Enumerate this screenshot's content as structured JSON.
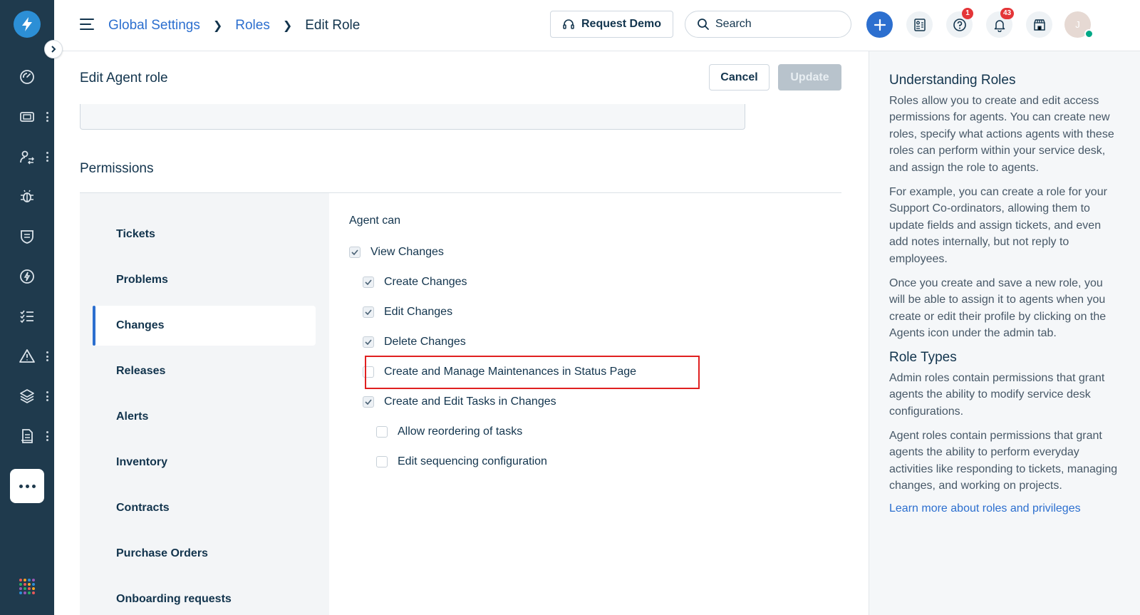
{
  "colors": {
    "sidebar_bg": "#1f3a4d",
    "accent": "#2c6fcf",
    "badge": "#e43538",
    "highlight": "#e02020",
    "online": "#00a886"
  },
  "header": {
    "breadcrumb": [
      "Global Settings",
      "Roles",
      "Edit Role"
    ],
    "demo_label": "Request Demo",
    "search_placeholder": "Search",
    "help_badge": "1",
    "notif_badge": "43",
    "avatar_initial": "J"
  },
  "nav_icons": [
    "dashboard-icon",
    "tickets-icon",
    "changes-icon",
    "problems-icon",
    "releases-icon",
    "alerts-icon",
    "tasks-icon",
    "assets-icon",
    "inventory-icon",
    "reports-icon"
  ],
  "page": {
    "title": "Edit Agent role",
    "cancel": "Cancel",
    "update": "Update",
    "permissions_title": "Permissions"
  },
  "perm_nav": [
    "Tickets",
    "Problems",
    "Changes",
    "Releases",
    "Alerts",
    "Inventory",
    "Contracts",
    "Purchase Orders",
    "Onboarding requests"
  ],
  "perm_nav_active": "Changes",
  "agent_can": "Agent can",
  "permissions": [
    {
      "label": "View Changes",
      "checked": true,
      "level": 0
    },
    {
      "label": "Create Changes",
      "checked": true,
      "level": 1
    },
    {
      "label": "Edit Changes",
      "checked": true,
      "level": 1
    },
    {
      "label": "Delete Changes",
      "checked": true,
      "level": 1
    },
    {
      "label": "Create and Manage Maintenances in Status Page",
      "checked": false,
      "level": 1
    },
    {
      "label": "Create and Edit Tasks in Changes",
      "checked": true,
      "level": 1
    },
    {
      "label": "Allow reordering of tasks",
      "checked": false,
      "level": 2
    },
    {
      "label": "Edit sequencing configuration",
      "checked": false,
      "level": 2
    }
  ],
  "help": {
    "title1": "Understanding Roles",
    "p1": "Roles allow you to create and edit access permissions for agents. You can create new roles, specify what actions agents with these roles can perform within your service desk, and assign the role to agents.",
    "p2": "For example, you can create a role for your Support Co-ordinators, allowing them to update fields and assign tickets, and even add notes internally, but not reply to employees.",
    "p3": "Once you create and save a new role, you will be able to assign it to agents when you create or edit their profile by clicking on the Agents icon under the admin tab.",
    "title2": "Role Types",
    "p4": "Admin roles contain permissions that grant agents the ability to modify service desk configurations.",
    "p5": "Agent roles contain permissions that grant agents the ability to perform everyday activities like responding to tickets, managing changes, and working on projects.",
    "link": "Learn more about roles and privileges"
  }
}
